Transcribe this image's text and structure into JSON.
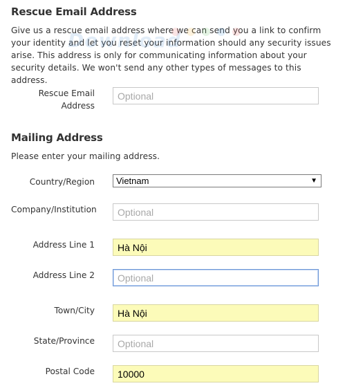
{
  "rescue": {
    "title": "Rescue Email Address",
    "description": "Give us a rescue email address where we can send you a link to confirm your identity and let you reset your information should any security issues arise. This address is only for communicating information about your security details. We won't send any other types of messages to this address.",
    "email_label": "Rescue Email Address",
    "email_value": "",
    "email_placeholder": "Optional"
  },
  "mailing": {
    "title": "Mailing Address",
    "description": "Please enter your mailing address.",
    "country_label": "Country/Region",
    "country_value": "Vietnam",
    "company_label": "Company/Institution",
    "company_value": "",
    "company_placeholder": "Optional",
    "address1_label": "Address Line 1",
    "address1_value": "Hà Nội",
    "address2_label": "Address Line 2",
    "address2_value": "",
    "address2_placeholder": "Optional",
    "town_label": "Town/City",
    "town_value": "Hà Nội",
    "state_label": "State/Province",
    "state_value": "",
    "state_placeholder": "Optional",
    "postal_label": "Postal Code",
    "postal_value": "10000"
  },
  "watermark": {
    "text": "Download",
    "dot_colors": [
      "#e86a6a",
      "#f4b740",
      "#6cc46c",
      "#5aa0e0",
      "#e86a6a"
    ]
  },
  "colors": {
    "autofill_bg": "#fcfbb9",
    "focus_border": "#6b95d6"
  }
}
